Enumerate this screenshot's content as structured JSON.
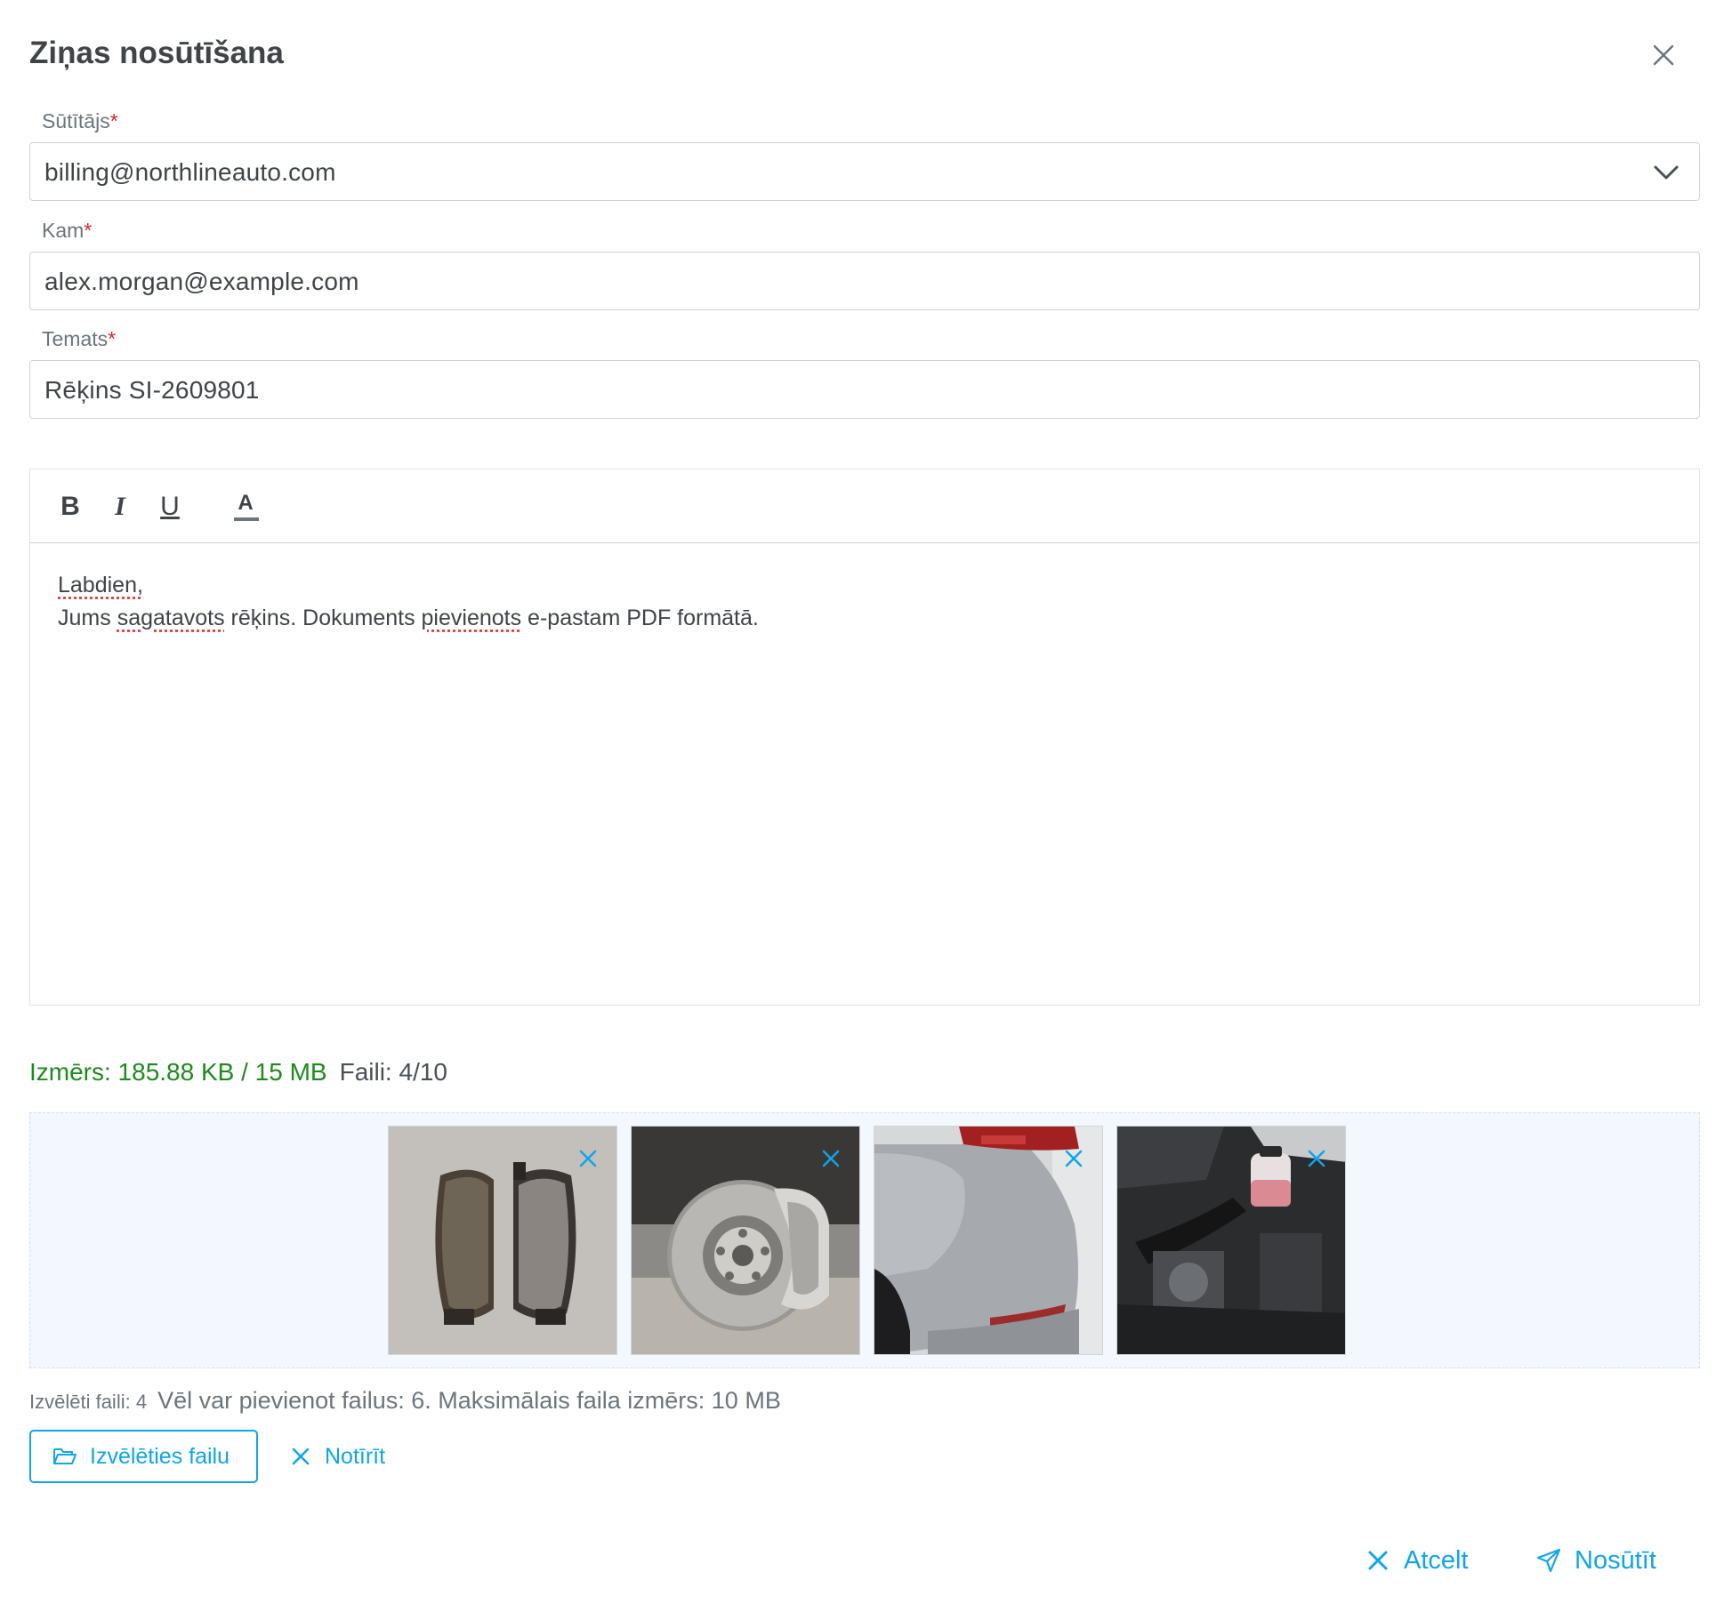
{
  "dialog": {
    "title": "Ziņas nosūtīšana"
  },
  "sender": {
    "label": "Sūtītājs",
    "required": "*",
    "value": "billing@northlineauto.com"
  },
  "recipient": {
    "label": "Kam",
    "required": "*",
    "value": "alex.morgan@example.com"
  },
  "subject": {
    "label": "Temats",
    "required": "*",
    "value": "Rēķins SI-2609801"
  },
  "toolbar": {
    "bold": "B",
    "italic": "I",
    "underline": "U",
    "color": "A"
  },
  "body": {
    "greeting": "Labdien,",
    "line2_a": "Jums ",
    "line2_b": "sagatavots",
    "line2_c": " rēķins. Dokuments ",
    "line2_d": "pievienots",
    "line2_e": " e-pastam PDF formātā."
  },
  "attachments": {
    "size_text": "Izmērs: 185.88 KB / 15 MB",
    "count_text": "Faili: 4/10",
    "files": [
      {
        "icon": "brake-pads-photo"
      },
      {
        "icon": "brake-disc-caliper-photo"
      },
      {
        "icon": "rear-bumper-photo"
      },
      {
        "icon": "engine-bay-photo"
      }
    ],
    "selected_text": "Izvēlēti faili: 4",
    "limits_text": "Vēl var pievienot failus: 6. Maksimālais faila izmērs: 10 MB",
    "choose_label": "Izvēlēties failu",
    "clear_label": "Notīrīt"
  },
  "footer": {
    "cancel_label": "Atcelt",
    "send_label": "Nosūtīt"
  },
  "colors": {
    "accent": "#0ea5e9",
    "required": "#e02424",
    "size_ok": "#1e8a1e"
  }
}
